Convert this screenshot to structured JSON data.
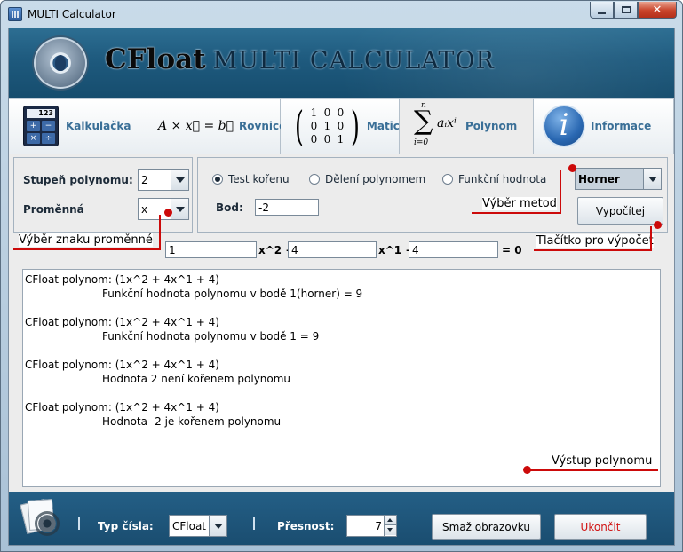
{
  "window": {
    "title": "MULTI Calculator",
    "controls": [
      "minimize",
      "maximize",
      "close"
    ]
  },
  "banner": {
    "brand_main": "CFloat",
    "brand_sub": "MULTI CALCULATOR"
  },
  "tabs": [
    {
      "label": "Kalkulačka",
      "icon": "calculator-icon",
      "calc_display": "123",
      "calc_keys": [
        "+",
        "−",
        "×",
        "÷"
      ]
    },
    {
      "label": "Rovnice",
      "icon": "equation-formula",
      "formula": "A × x⃗ = b⃗"
    },
    {
      "label": "Matice",
      "icon": "identity-matrix",
      "matrix": [
        "1",
        "0",
        "0",
        "0",
        "1",
        "0",
        "0",
        "0",
        "1"
      ]
    },
    {
      "label": "Polynom",
      "icon": "sum-formula",
      "sum_top": "n",
      "sum_bottom": "i=0",
      "sum_term": "aᵢxⁱ"
    },
    {
      "label": "Informace",
      "icon": "info-icon",
      "glyph": "i"
    }
  ],
  "active_tab": "Polynom",
  "settings": {
    "degree_label": "Stupeň polynomu:",
    "degree_value": "2",
    "variable_label": "Proměnná",
    "variable_value": "x",
    "radio_test": "Test kořenu",
    "radio_division": "Dělení polynomem",
    "radio_function": "Funkční hodnota",
    "selected_radio": "Test kořenu",
    "method_value": "Horner",
    "point_label": "Bod:",
    "point_value": "-2",
    "compute_button": "Vypočítej"
  },
  "coefficients": {
    "c2": "1",
    "c1": "4",
    "c0": "4",
    "term2": "x^2 +",
    "term1": "x^1 +",
    "suffix": "= 0"
  },
  "annotations": {
    "variable_sign": "Výběr znaku proměnné",
    "method_choice": "Výběr metod",
    "compute_button": "Tlačítko pro výpočet",
    "output": "Výstup polynomu"
  },
  "output": {
    "lines": [
      {
        "text": "CFloat polynom: (1x^2 + 4x^1 + 4)",
        "indent": false
      },
      {
        "text": "Funkční hodnota polynomu v bodě 1(horner) = 9",
        "indent": true
      },
      {
        "text": "CFloat polynom: (1x^2 + 4x^1 + 4)",
        "indent": false
      },
      {
        "text": "Funkční hodnota polynomu v bodě 1 = 9",
        "indent": true
      },
      {
        "text": "CFloat polynom: (1x^2 + 4x^1 + 4)",
        "indent": false
      },
      {
        "text": "Hodnota 2 není kořenem polynomu",
        "indent": true
      },
      {
        "text": "CFloat polynom: (1x^2 + 4x^1 + 4)",
        "indent": false
      },
      {
        "text": "Hodnota -2 je kořenem polynomu",
        "indent": true
      }
    ]
  },
  "bottom_bar": {
    "number_type_label": "Typ čísla:",
    "number_type_value": "CFloat",
    "precision_label": "Přesnost:",
    "precision_value": "7",
    "clear_button": "Smaž obrazovku",
    "quit_button": "Ukončit",
    "separator": "|"
  },
  "colors": {
    "accent_blue": "#3a6f97",
    "annotation_red": "#cc0a0a",
    "quit_red": "#d11414",
    "toolbar_blue": "#1e5a7e"
  }
}
